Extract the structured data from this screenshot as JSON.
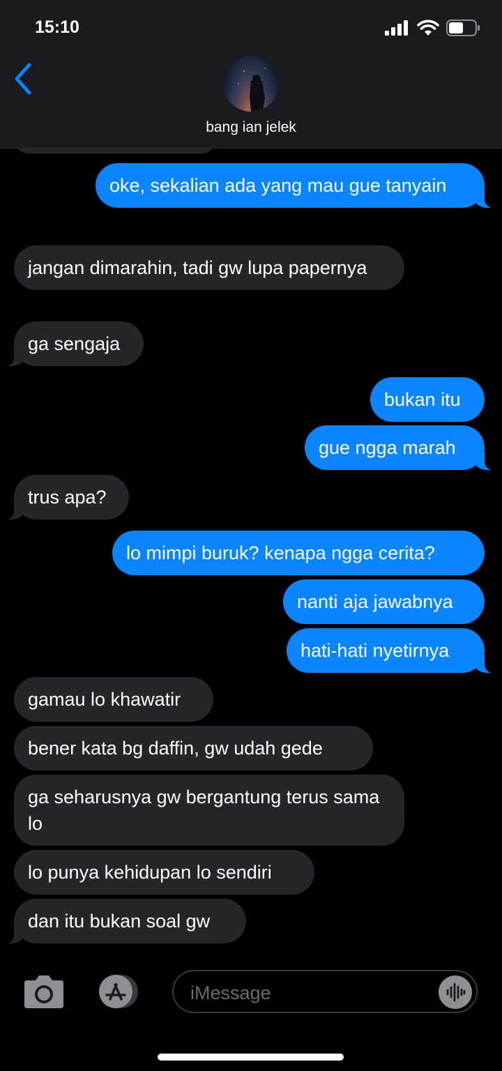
{
  "status_bar": {
    "time": "15:10",
    "battery_level": 0.55
  },
  "header": {
    "contact_name": "bang ian jelek",
    "back_icon": "chevron-left-icon"
  },
  "colors": {
    "accent": "#0a84ff",
    "incoming_bubble": "#262628",
    "background": "#000000",
    "header": "#1b1b1d"
  },
  "messages": [
    {
      "from": "me",
      "text": "oke, sekalian ada yang mau gue tanyain"
    },
    {
      "from": "them",
      "text": "jangan dimarahin, tadi gw lupa papernya"
    },
    {
      "from": "them",
      "text": "ga sengaja"
    },
    {
      "from": "me",
      "text": "bukan itu"
    },
    {
      "from": "me",
      "text": "gue ngga marah"
    },
    {
      "from": "them",
      "text": "trus apa?"
    },
    {
      "from": "me",
      "text": "lo mimpi buruk? kenapa ngga cerita?"
    },
    {
      "from": "me",
      "text": "nanti aja jawabnya"
    },
    {
      "from": "me",
      "text": "hati-hati nyetirnya"
    },
    {
      "from": "them",
      "text": "gamau lo khawatir"
    },
    {
      "from": "them",
      "text": "bener kata bg daffin, gw udah gede"
    },
    {
      "from": "them",
      "text": "ga seharusnya gw bergantung terus sama lo"
    },
    {
      "from": "them",
      "text": "lo punya kehidupan lo sendiri"
    },
    {
      "from": "them",
      "text": "dan itu bukan soal gw"
    }
  ],
  "composer": {
    "placeholder": "iMessage",
    "camera_icon": "camera-icon",
    "apps_icon": "app-store-icon",
    "audio_icon": "audio-waveform-icon"
  }
}
